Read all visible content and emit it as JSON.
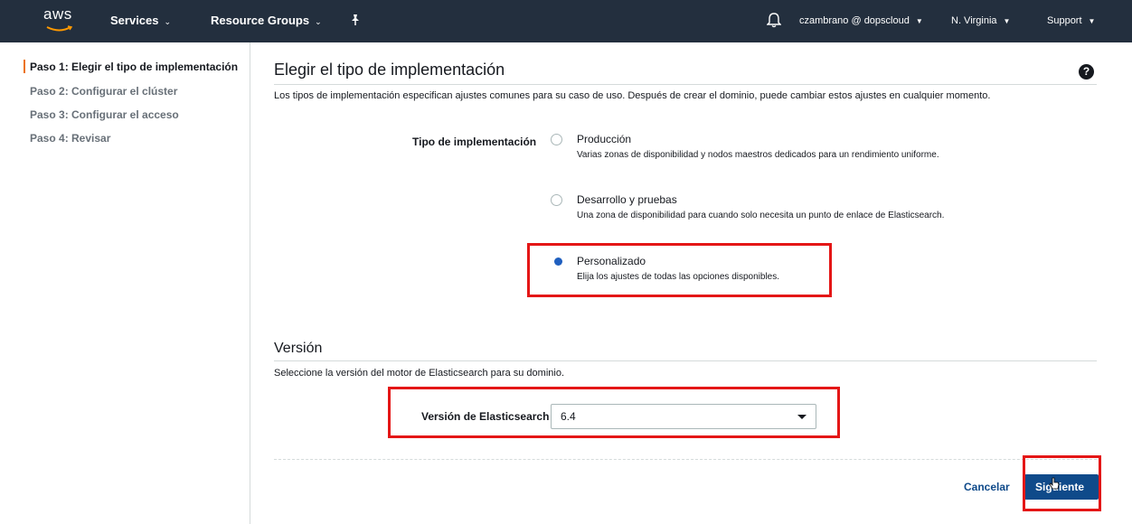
{
  "topbar": {
    "logo_text": "aws",
    "services": "Services",
    "resource_groups": "Resource Groups",
    "account": "czambrano @ dopscloud",
    "region": "N. Virginia",
    "support": "Support"
  },
  "sidebar": {
    "steps": [
      "Paso 1: Elegir el tipo de implementación",
      "Paso 2: Configurar el clúster",
      "Paso 3: Configurar el acceso",
      "Paso 4: Revisar"
    ]
  },
  "main": {
    "title": "Elegir el tipo de implementación",
    "help": "?",
    "description": "Los tipos de implementación especifican ajustes comunes para su caso de uso. Después de crear el dominio, puede cambiar estos ajustes en cualquier momento.",
    "deployment_label": "Tipo de implementación",
    "options": [
      {
        "title": "Producción",
        "desc": "Varias zonas de disponibilidad y nodos maestros dedicados para un rendimiento uniforme.",
        "selected": false
      },
      {
        "title": "Desarrollo y pruebas",
        "desc": "Una zona de disponibilidad para cuando solo necesita un punto de enlace de Elasticsearch.",
        "selected": false
      },
      {
        "title": "Personalizado",
        "desc": "Elija los ajustes de todas las opciones disponibles.",
        "selected": true
      }
    ]
  },
  "version": {
    "title": "Versión",
    "description": "Seleccione la versión del motor de Elasticsearch para su dominio.",
    "label": "Versión de Elasticsearch",
    "value": "6.4"
  },
  "footer": {
    "cancel": "Cancelar",
    "next": "Siguiente"
  },
  "colors": {
    "topbar": "#232f3e",
    "accent": "#ec7211",
    "primary": "#0f4a8a",
    "highlight": "#e41616"
  }
}
